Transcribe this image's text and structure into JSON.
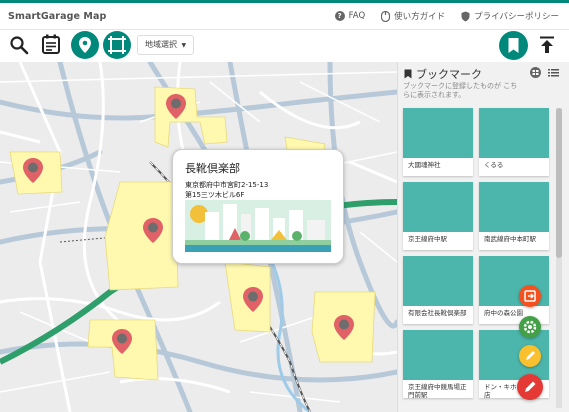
{
  "header": {
    "brand": "SmartGarage Map",
    "links": [
      {
        "label": "FAQ",
        "icon": "question-icon"
      },
      {
        "label": "使い方ガイド",
        "icon": "mouse-icon"
      },
      {
        "label": "プライバシーポリシー",
        "icon": "shield-icon"
      }
    ]
  },
  "toolbar": {
    "region_label": "地域選択"
  },
  "popup": {
    "title": "長靴倶楽部",
    "address": "東京都府中市宮町2-15-13",
    "building": "第15三ツ木ビル6F"
  },
  "sidebar": {
    "title": "ブックマーク",
    "subtitle": "ブックマークに登録したものが こちらに表示されます。",
    "cards": [
      {
        "label": "大國魂神社"
      },
      {
        "label": "くるる"
      },
      {
        "label": "京王線府中駅"
      },
      {
        "label": "南武線府中本町駅"
      },
      {
        "label": "有限会社長靴倶楽部"
      },
      {
        "label": "府中の森公園"
      },
      {
        "label": "京王線府中競馬場正門前駅"
      },
      {
        "label": "ドン・キホーテ府中店"
      }
    ]
  },
  "colors": {
    "accent": "#00897b",
    "card": "#4db6ac",
    "area": "#fff9b0",
    "pin": "#e06266",
    "rail": "#2e9e6b"
  }
}
